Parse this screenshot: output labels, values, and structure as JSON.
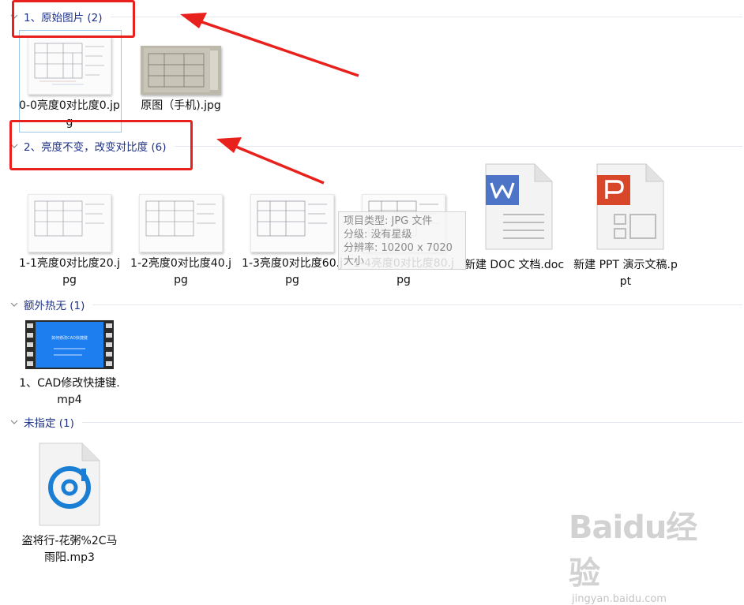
{
  "groups": [
    {
      "title": "1、原始图片 (2)"
    },
    {
      "title": "2、亮度不变，改变对比度 (6)"
    },
    {
      "title": "额外热无 (1)"
    },
    {
      "title": "未指定 (1)"
    }
  ],
  "files": {
    "g1": [
      {
        "name": "0-0亮度0对比度0.jpg",
        "icon": "blueprint-thumbnail"
      },
      {
        "name": "原图（手机).jpg",
        "icon": "photo-thumbnail"
      }
    ],
    "g2": [
      {
        "name": "1-1亮度0对比度20.jpg",
        "icon": "blueprint-thumbnail"
      },
      {
        "name": "1-2亮度0对比度40.jpg",
        "icon": "blueprint-thumbnail"
      },
      {
        "name": "1-3亮度0对比度60.jpg",
        "icon": "blueprint-thumbnail"
      },
      {
        "name": "1-4亮度0对比度80.jpg",
        "icon": "blueprint-thumbnail"
      },
      {
        "name": "新建 DOC 文档.doc",
        "icon": "wps-writer-doc-icon"
      },
      {
        "name": "新建 PPT 演示文稿.ppt",
        "icon": "wps-presentation-icon"
      }
    ],
    "g3": [
      {
        "name": "1、CAD修改快捷键.mp4",
        "icon": "video-thumbnail"
      }
    ],
    "g4": [
      {
        "name": "盗将行-花粥%2C马雨阳.mp3",
        "icon": "music-file-icon"
      }
    ]
  },
  "video_thumb_title": "如何修改CAD快捷键",
  "tooltip": {
    "lines": [
      "项目类型: JPG 文件",
      "分级: 没有星级",
      "分辨率: 10200 x 7020",
      "大小"
    ]
  },
  "watermark": {
    "brand": "Baidu经验",
    "url": "jingyan.baidu.com"
  },
  "colors": {
    "header_text": "#1e3287",
    "annotation_red": "#e8211c",
    "selection_border": "#9bc7e8",
    "wps_doc": "#4e74c8",
    "wps_ppt": "#d9472b",
    "mp3_blue": "#1a7fd4"
  }
}
